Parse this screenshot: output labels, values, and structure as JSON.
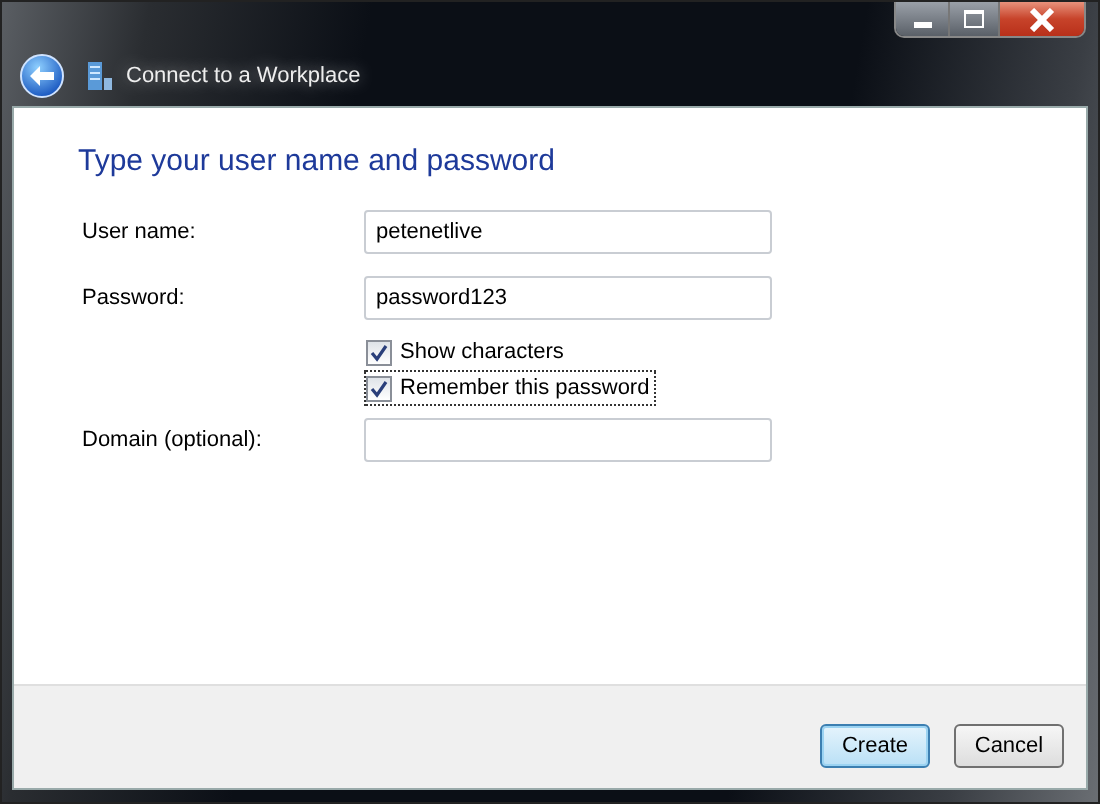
{
  "window": {
    "title": "Connect to a Workplace"
  },
  "heading": "Type your user name and password",
  "fields": [
    {
      "label": "User name:",
      "value": "petenetlive"
    },
    {
      "label": "Password:",
      "value": "password123"
    }
  ],
  "checkboxes": [
    {
      "label": "Show characters",
      "checked": true,
      "focused": false
    },
    {
      "label": "Remember this password",
      "checked": true,
      "focused": true
    }
  ],
  "domain": {
    "label": "Domain (optional):"
  },
  "buttons": [
    {
      "label": "Create",
      "default": true
    },
    {
      "label": "Cancel",
      "default": false
    }
  ]
}
